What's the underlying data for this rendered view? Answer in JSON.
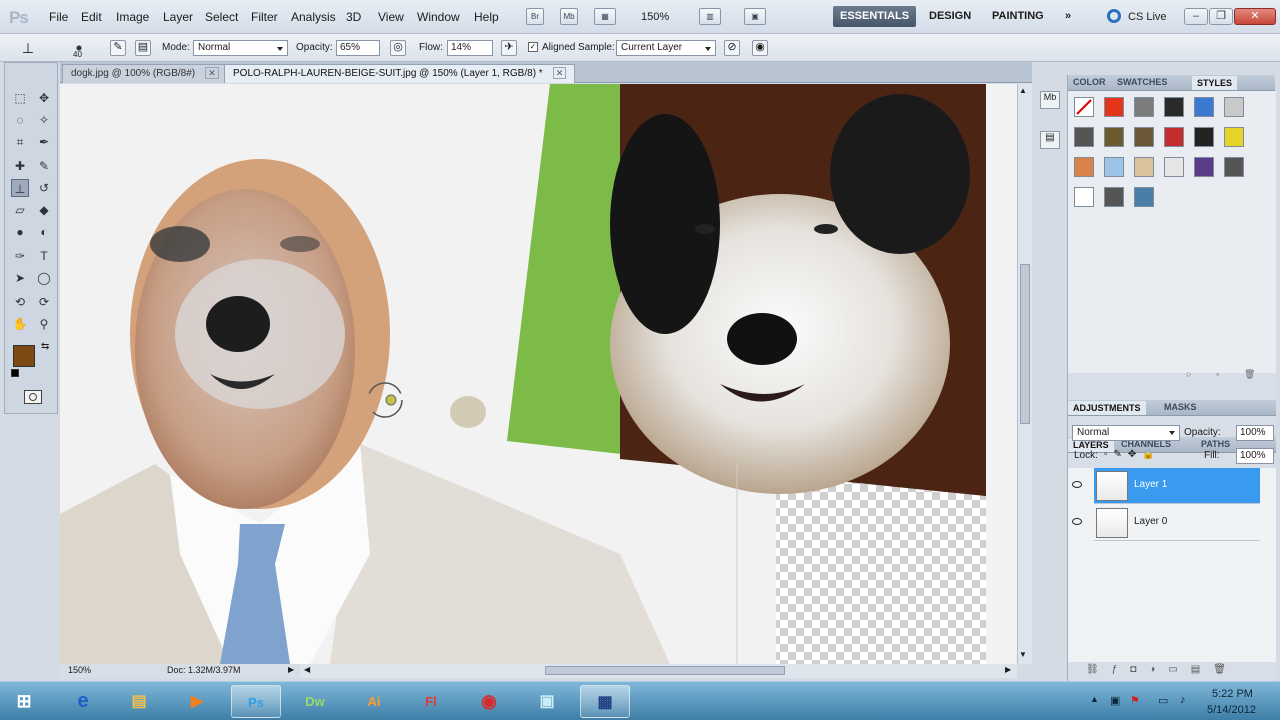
{
  "app": {
    "logo": "Ps"
  },
  "menubar": {
    "menus": [
      "File",
      "Edit",
      "Image",
      "Layer",
      "Select",
      "Filter",
      "Analysis",
      "3D",
      "View",
      "Window",
      "Help"
    ],
    "mini_buttons": [
      "Br",
      "Mb"
    ],
    "zoom": "150%",
    "workspaces": [
      "ESSENTIALS",
      "DESIGN",
      "PAINTING"
    ],
    "more": "»",
    "cs_live": "CS Live",
    "window_buttons": {
      "minimize": "–",
      "restore": "❐",
      "close": "✕"
    }
  },
  "options": {
    "brush_size": "40",
    "mode_label": "Mode:",
    "mode_value": "Normal",
    "opacity_label": "Opacity:",
    "opacity_value": "65%",
    "flow_label": "Flow:",
    "flow_value": "14%",
    "aligned_label": "Aligned",
    "sample_label": "Sample:",
    "sample_value": "Current Layer"
  },
  "tabs": [
    {
      "label": "dogk.jpg @ 100% (RGB/8#)",
      "active": false
    },
    {
      "label": "POLO-RALPH-LAUREN-BEIGE-SUIT.jpg @ 150% (Layer 1, RGB/8) *",
      "active": true
    }
  ],
  "tab_close": "✕",
  "status": {
    "zoom": "150%",
    "doc": "Doc: 1.32M/3.97M"
  },
  "colors": {
    "foreground": "#7a4a12",
    "background": "#ffffff",
    "accent": "#3a9af0"
  },
  "panels": {
    "top_tabs": [
      "COLOR",
      "SWATCHES",
      "STYLES"
    ],
    "mid_tabs": [
      "ADJUSTMENTS",
      "MASKS"
    ],
    "layer_tabs": [
      "LAYERS",
      "CHANNELS",
      "PATHS"
    ],
    "blend_mode": "Normal",
    "opacity_label": "Opacity:",
    "opacity_value": "100%",
    "lock_label": "Lock:",
    "fill_label": "Fill:",
    "fill_value": "100%",
    "layers": [
      {
        "name": "Layer 1",
        "selected": true
      },
      {
        "name": "Layer 0",
        "selected": false
      }
    ]
  },
  "taskbar": {
    "apps": [
      {
        "name": "start-icon",
        "label": "⊞"
      },
      {
        "name": "ie-icon",
        "label": "e"
      },
      {
        "name": "explorer-icon",
        "label": "▤"
      },
      {
        "name": "media-player-icon",
        "label": "▶"
      },
      {
        "name": "photoshop-icon",
        "label": "Ps"
      },
      {
        "name": "dreamweaver-icon",
        "label": "Dw"
      },
      {
        "name": "illustrator-icon",
        "label": "Ai"
      },
      {
        "name": "flash-icon",
        "label": "Fl"
      },
      {
        "name": "chrome-icon",
        "label": "◉"
      },
      {
        "name": "remote-desktop-icon",
        "label": "▣"
      },
      {
        "name": "screen-capture-icon",
        "label": "▦"
      }
    ],
    "time": "5:22 PM",
    "date": "5/14/2012"
  }
}
